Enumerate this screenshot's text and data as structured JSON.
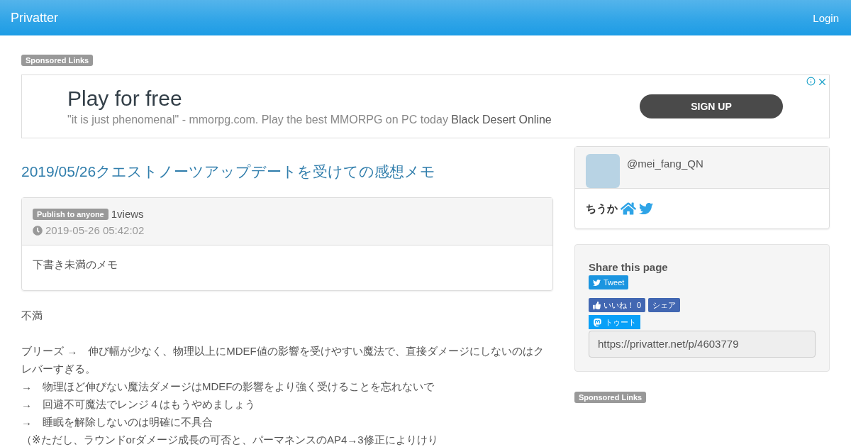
{
  "navbar": {
    "brand": "Privatter",
    "login": "Login"
  },
  "sponsored_top": "Sponsored Links",
  "ad": {
    "headline": "Play for free",
    "description": "\"it is just phenomenal\" - mmorpg.com. Play the best MMORPG on PC today",
    "advertiser": "Black Desert Online",
    "cta": "SIGN UP"
  },
  "post": {
    "title": "2019/05/26クエストノーツアップデートを受けての感想メモ",
    "visibility": "Publish to anyone",
    "views": "1views",
    "date": "2019-05-26 05:42:02",
    "summary": "下書き未満のメモ",
    "paragraphs": [
      {
        "lines": [
          "不満"
        ]
      },
      {
        "lines": [
          "ブリーズ →　伸び幅が少なく、物理以上にMDEF値の影響を受けやすい魔法で、直接ダメージにしないのはクレバーすぎる。",
          "→　物理ほど伸びない魔法ダメージはMDEFの影響をより強く受けることを忘れないで",
          "→　回避不可魔法でレンジ４はもうやめましょう",
          "→　睡眠を解除しないのは明確に不具合",
          "（※ただし、ラウンドorダメージ成長の可否と、パーマネンスのAP4→3修正によりけり"
        ]
      }
    ]
  },
  "profile": {
    "handle": "@mei_fang_QN",
    "name": "ちうか"
  },
  "share": {
    "title": "Share this page",
    "tweet": "Tweet",
    "like": "いいね！ 0",
    "fb_share": "シェア",
    "toot": "トゥート",
    "url": "https://privatter.net/p/4603779"
  },
  "sponsored_side": "Sponsored Links"
}
